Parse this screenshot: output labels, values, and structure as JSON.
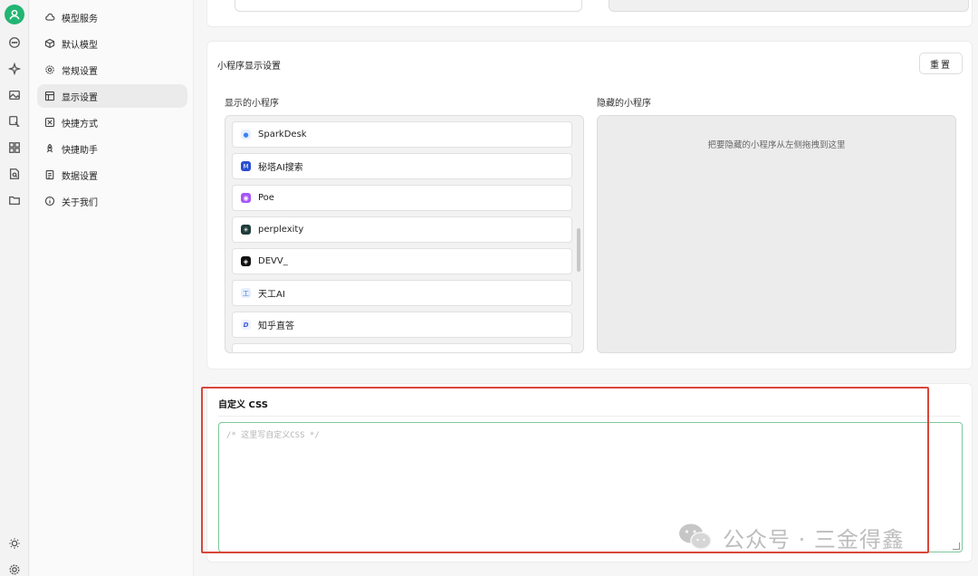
{
  "nav": {
    "items": [
      {
        "label": "模型服务",
        "icon": "cloud-icon",
        "active": false
      },
      {
        "label": "默认模型",
        "icon": "cube-icon",
        "active": false
      },
      {
        "label": "常规设置",
        "icon": "gear-icon",
        "active": false
      },
      {
        "label": "显示设置",
        "icon": "layout-icon",
        "active": true
      },
      {
        "label": "快捷方式",
        "icon": "command-icon",
        "active": false
      },
      {
        "label": "快捷助手",
        "icon": "rocket-icon",
        "active": false
      },
      {
        "label": "数据设置",
        "icon": "database-icon",
        "active": false
      },
      {
        "label": "关于我们",
        "icon": "info-icon",
        "active": false
      }
    ]
  },
  "miniapps": {
    "section_title": "小程序显示设置",
    "reset_label": "重置",
    "visible_title": "显示的小程序",
    "hidden_title": "隐藏的小程序",
    "hidden_hint": "把要隐藏的小程序从左侧拖拽到这里",
    "apps": [
      {
        "name": "SparkDesk",
        "color": "#3b82f6"
      },
      {
        "name": "秘塔AI搜索",
        "color": "#2b4ecf"
      },
      {
        "name": "Poe",
        "color": "#a855f7"
      },
      {
        "name": "perplexity",
        "color": "#1f3b3b"
      },
      {
        "name": "DEVV_",
        "color": "#111111"
      },
      {
        "name": "天工AI",
        "color": "#4a7bd8"
      },
      {
        "name": "知乎直答",
        "color": "#3b5bdb"
      }
    ]
  },
  "custom_css": {
    "title": "自定义 CSS",
    "placeholder": "/* 这里写自定义CSS */"
  },
  "watermark": {
    "text": "公众号 · 三金得鑫"
  },
  "colors": {
    "brand_green": "#22b573",
    "highlight_red": "#d9463b",
    "editor_border": "#7cc89a"
  }
}
